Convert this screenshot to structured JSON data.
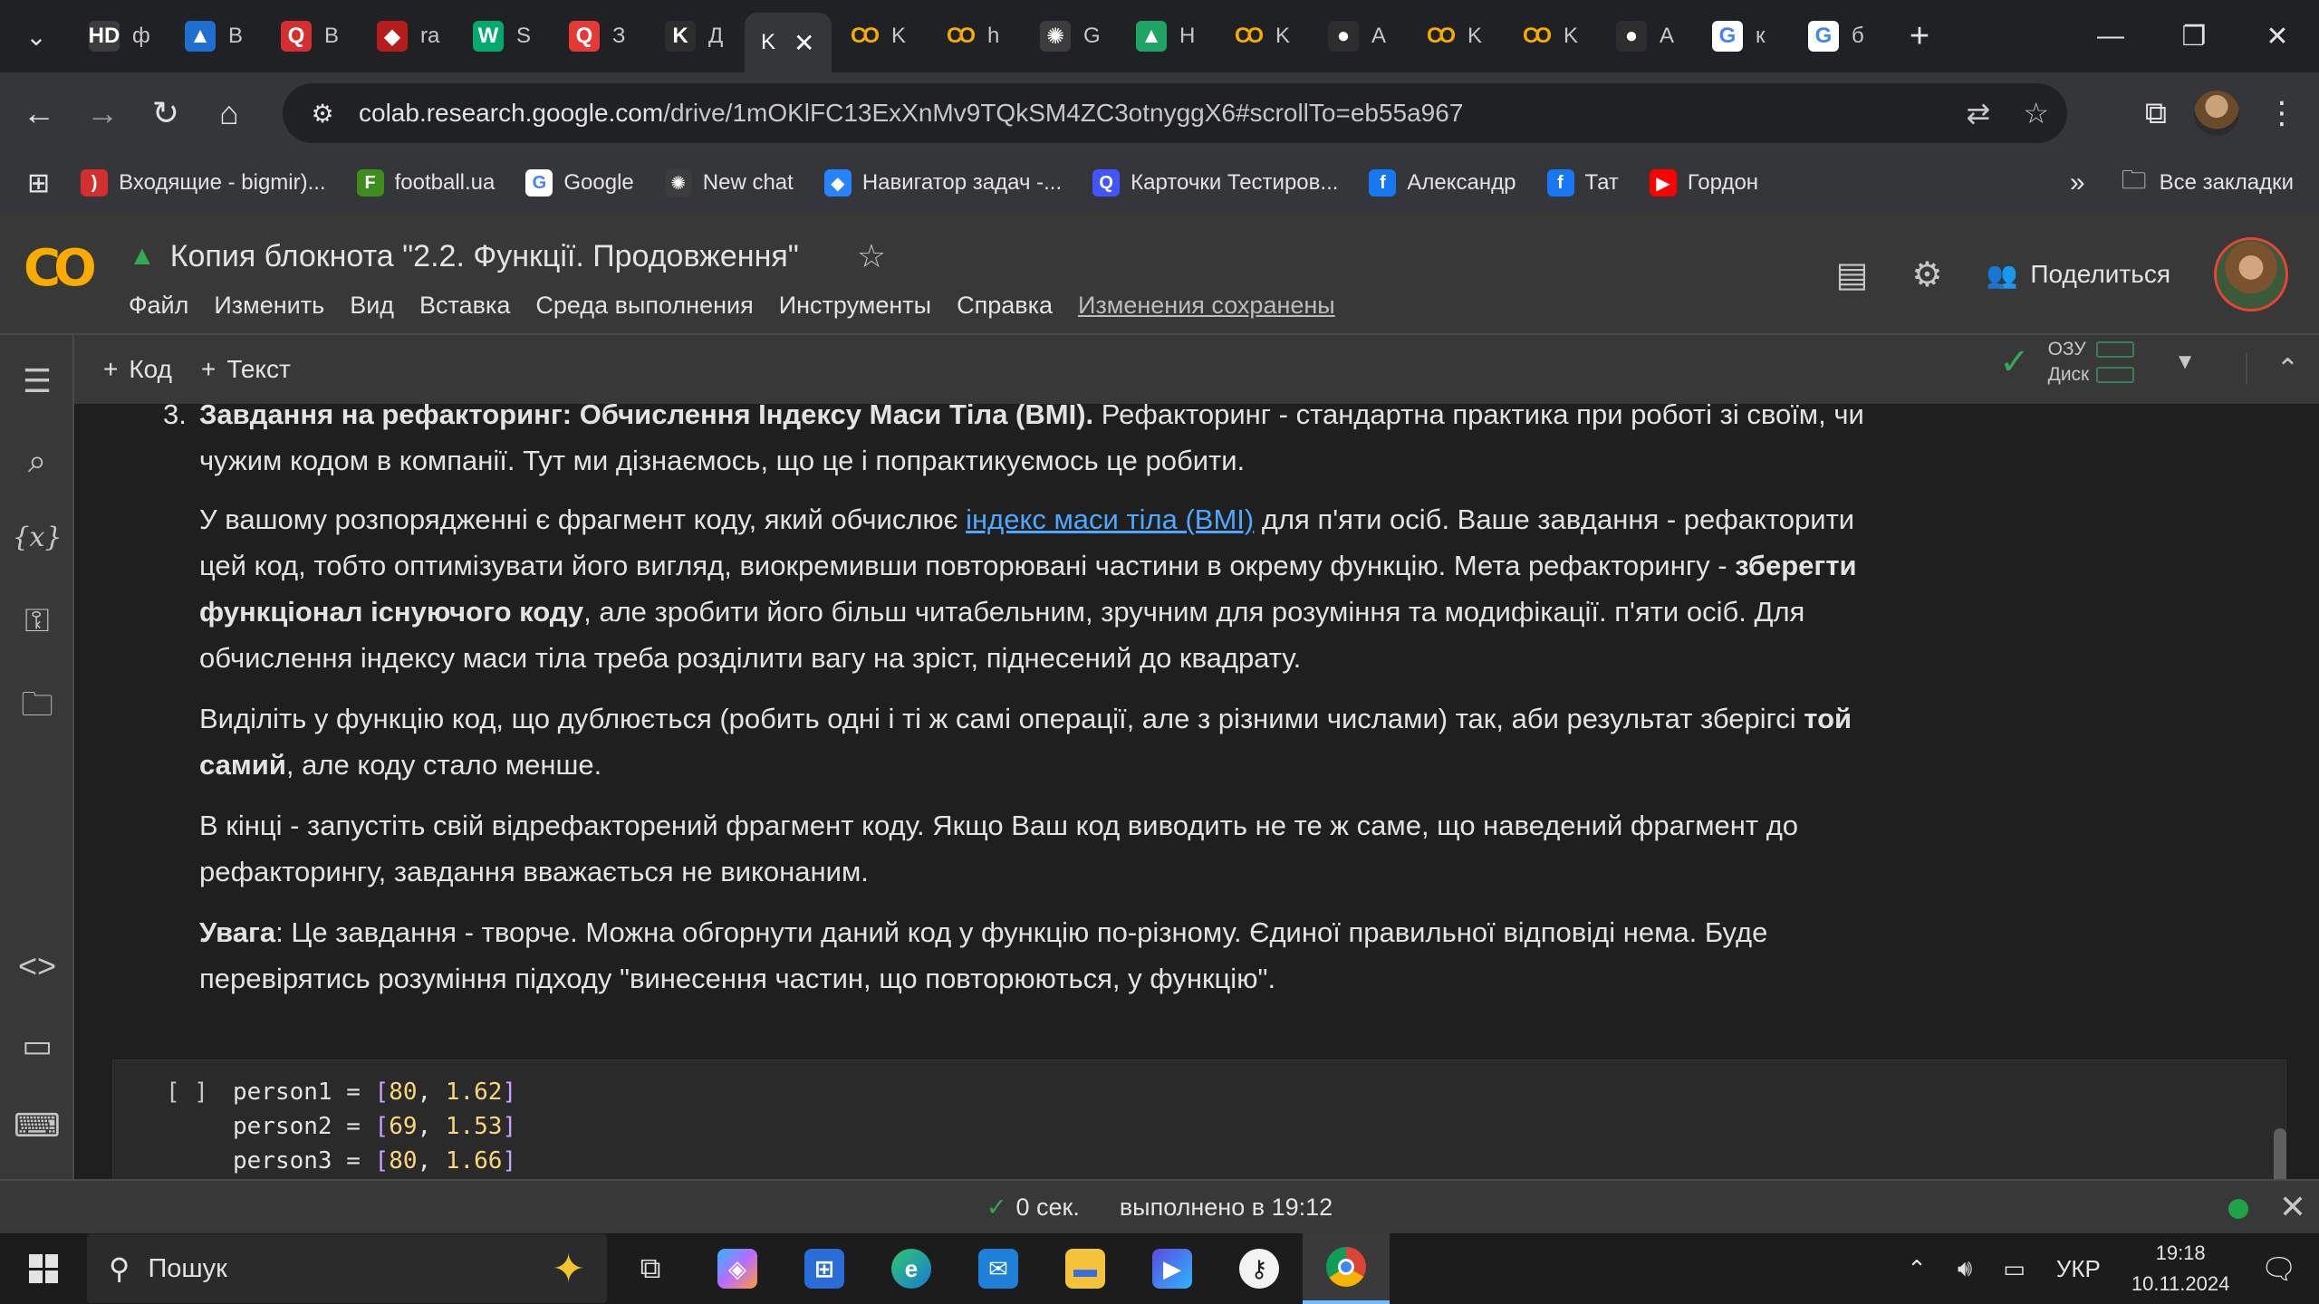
{
  "browser": {
    "tabs": [
      {
        "letter": "ф",
        "icon": "hd-icon",
        "color": "#3c3c3c",
        "glyph": "HD"
      },
      {
        "letter": "B",
        "icon": "azure-devops-icon",
        "color": "#1f6fd1",
        "glyph": "▲"
      },
      {
        "letter": "B",
        "icon": "red-q-icon",
        "color": "#d32f2f",
        "glyph": "Q"
      },
      {
        "letter": "ra",
        "icon": "red-shape-icon",
        "color": "#b71c1c",
        "glyph": "◆"
      },
      {
        "letter": "S",
        "icon": "w3schools-icon",
        "color": "#04aa6d",
        "glyph": "W"
      },
      {
        "letter": "З",
        "icon": "red-q2-icon",
        "color": "#e53935",
        "glyph": "Q"
      },
      {
        "letter": "Д",
        "icon": "k-icon",
        "color": "#2d2d2d",
        "glyph": "K"
      }
    ],
    "active_tab": {
      "letter": "K"
    },
    "tabs_after": [
      {
        "letter": "K",
        "icon": "colab-icon",
        "color": "#f9ab00",
        "glyph": "CO"
      },
      {
        "letter": "h",
        "icon": "colab-icon",
        "color": "#f9ab00",
        "glyph": "CO"
      },
      {
        "letter": "G",
        "icon": "chatgpt-icon",
        "color": "#3c3c3c",
        "glyph": "✺"
      },
      {
        "letter": "H",
        "icon": "drive-icon",
        "color": "#1fa463",
        "glyph": "▲"
      },
      {
        "letter": "K",
        "icon": "colab-icon",
        "color": "#f9ab00",
        "glyph": "CO"
      },
      {
        "letter": "A",
        "icon": "github-icon",
        "color": "#2d2d2d",
        "glyph": "●"
      },
      {
        "letter": "K",
        "icon": "colab-icon",
        "color": "#f9ab00",
        "glyph": "CO"
      },
      {
        "letter": "K",
        "icon": "colab-icon",
        "color": "#f9ab00",
        "glyph": "CO"
      },
      {
        "letter": "A",
        "icon": "github-icon",
        "color": "#2d2d2d",
        "glyph": "●"
      },
      {
        "letter": "к",
        "icon": "google-icon",
        "color": "#ffffff",
        "glyph": "G"
      },
      {
        "letter": "б",
        "icon": "google-icon",
        "color": "#ffffff",
        "glyph": "G"
      }
    ],
    "url_host": "colab.research.google.com",
    "url_path": "/drive/1mOKlFC13ExXnMv9TQkSM4ZC3otnyggX6#scrollTo=eb55a967",
    "bookmarks": [
      {
        "label": "Входящие - bigmir)...",
        "icon": "bigmir-icon",
        "color": "#d32f2f",
        "glyph": ")"
      },
      {
        "label": "football.ua",
        "icon": "football-ua-icon",
        "color": "#3c8c1e",
        "glyph": "F"
      },
      {
        "label": "Google",
        "icon": "google-icon",
        "color": "#ffffff",
        "glyph": "G"
      },
      {
        "label": "New chat",
        "icon": "chatgpt-icon",
        "color": "#3c3c3c",
        "glyph": "✺"
      },
      {
        "label": "Навигатор задач -...",
        "icon": "jira-icon",
        "color": "#2684ff",
        "glyph": "◆"
      },
      {
        "label": "Карточки Тестиров...",
        "icon": "quizlet-icon",
        "color": "#4255ff",
        "glyph": "Q"
      },
      {
        "label": "Александр",
        "icon": "facebook-icon",
        "color": "#1877f2",
        "glyph": "f"
      },
      {
        "label": "Тат",
        "icon": "facebook-icon",
        "color": "#1877f2",
        "glyph": "f"
      },
      {
        "label": "Гордон",
        "icon": "youtube-icon",
        "color": "#ff0000",
        "glyph": "▶"
      }
    ],
    "all_bookmarks": "Все закладки"
  },
  "colab": {
    "title": "Копия блокнота \"2.2. Функції. Продовження\"",
    "menu": [
      "Файл",
      "Изменить",
      "Вид",
      "Вставка",
      "Среда выполнения",
      "Инструменты",
      "Справка"
    ],
    "saved_status": "Изменения сохранены",
    "share_label": "Поделиться",
    "toolbar": {
      "add_code": "Код",
      "add_text": "Текст"
    },
    "resources": {
      "ram": "ОЗУ",
      "disk": "Диск"
    }
  },
  "notebook": {
    "item_number": "3.",
    "p1_bold": "Завдання на рефакторинг: Обчислення Індексу Маси Тіла (BMI).",
    "p1_rest_a": " Рефакторинг - стандартна практика при роботі зі своїм, чи",
    "p1_rest_b": "чужим кодом в компанії. Тут ми дізнаємось, що це і попрактикуємось це робити.",
    "p2_a": "У вашому розпорядженні є фрагмент коду, який обчислює ",
    "p2_link": "індекс маси тіла (BMI)",
    "p2_b": " для п'яти осіб. Ваше завдання - рефакторити",
    "p2_c": "цей код, тобто оптимізувати його вигляд, виокремивши повторювані частини в окрему функцію. Мета рефакторингу - ",
    "p2_bold1": "зберегти",
    "p2_bold2": "функціонал існуючого коду",
    "p2_d": ", але зробити його більш читабельним, зручним для розуміння та модифікації. п'яти осіб. Для",
    "p2_e": "обчислення індексу маси тіла треба розділити вагу на зріст, піднесений до квадрату.",
    "p3_a": "Виділіть у функцію код, що дублюється (робить одні і ті ж самі операції, але з різними числами) так, аби результат зберігсі ",
    "p3_bold1": "той",
    "p3_bold2": "самий",
    "p3_b": ", але коду стало менше.",
    "p4_a": "В кінці - запустіть свій відрефакторений фрагмент коду. Якщо Ваш код виводить не те ж саме, що наведений фрагмент до",
    "p4_b": "рефакторингу, завдання вважається не виконаним.",
    "p5_bold": "Увага",
    "p5_a": ": Це завдання - творче. Можна обгорнути даний код у функцію по-різному. Єдиної правильної відповіді нема. Буде",
    "p5_b": "перевірятись розуміння підходу \"винесення частин, що повторюються, у функцію\".",
    "run_marker": "[ ]",
    "code": [
      {
        "var": "person1",
        "a": "80",
        "b": "1.62"
      },
      {
        "var": "person2",
        "a": "69",
        "b": "1.53"
      },
      {
        "var": "person3",
        "a": "80",
        "b": "1.66"
      }
    ]
  },
  "status": {
    "duration": "0 сек.",
    "completed": "выполнено в 19:12"
  },
  "taskbar": {
    "search_placeholder": "Пошук",
    "lang": "УКР",
    "time": "19:18",
    "date": "10.11.2024"
  }
}
